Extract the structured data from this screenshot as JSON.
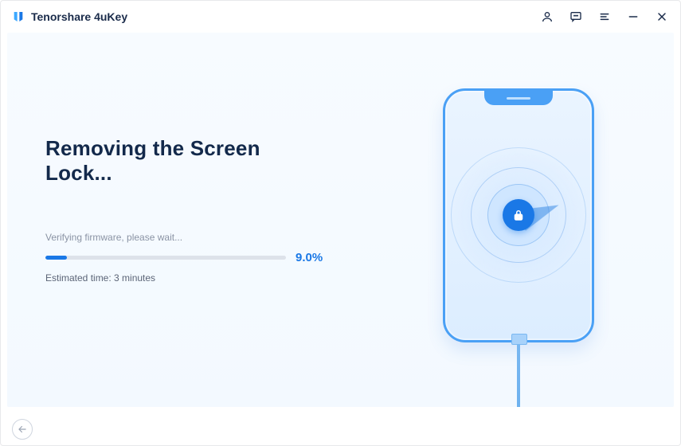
{
  "app": {
    "title": "Tenorshare 4uKey"
  },
  "titlebar": {
    "icons": {
      "account": "account-icon",
      "feedback": "feedback-icon",
      "menu": "menu-icon",
      "minimize": "minimize-icon",
      "close": "close-icon"
    }
  },
  "main": {
    "headline": "Removing the Screen Lock...",
    "status": "Verifying firmware, please wait...",
    "progress_percent": 9.0,
    "progress_display": "9.0%",
    "estimated_label": "Estimated time: 3 minutes"
  },
  "illustration": {
    "lock_icon": "lock-icon"
  },
  "footer": {
    "back": "back-icon"
  },
  "colors": {
    "accent": "#1a78e6",
    "heading": "#13294b",
    "muted": "#8a93a4"
  }
}
